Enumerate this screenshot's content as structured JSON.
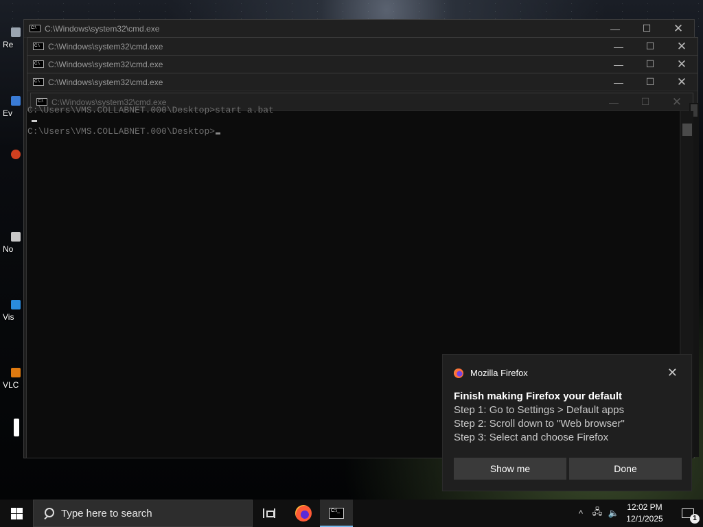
{
  "desktop": {
    "icons": [
      {
        "label": "Re",
        "color": "#9aa4b0"
      },
      {
        "label": "Ev",
        "color": "#3a7bd5"
      },
      {
        "label": "",
        "color": "#d04020"
      },
      {
        "label": "No",
        "color": "#c8c8c8"
      },
      {
        "label": "Vis",
        "color": "#2a8cde"
      },
      {
        "label": "VLC",
        "color": "#e07a10"
      },
      {
        "label": "",
        "color": "#ffffff"
      }
    ]
  },
  "windows": [
    {
      "title": "C:\\Windows\\system32\\cmd.exe",
      "icon_text": "C:\\"
    },
    {
      "title": "C:\\Windows\\system32\\cmd.exe",
      "icon_text": "C:\\"
    },
    {
      "title": "C:\\Windows\\system32\\cmd.exe",
      "icon_text": "C:\\"
    },
    {
      "title": "C:\\Windows\\system32\\cmd.exe",
      "icon_text": "C:\\"
    },
    {
      "title": "C:\\Windows\\system32\\cmd.exe",
      "icon_text": "C:\\"
    }
  ],
  "window_controls": {
    "minimize": "—",
    "maximize": "☐",
    "close": "✕"
  },
  "console": {
    "line1": "C:\\Users\\VMS.COLLABNET.000\\Desktop>start a.bat",
    "line2": "C:\\Users\\VMS.COLLABNET.000\\Desktop>"
  },
  "toast": {
    "app_name": "Mozilla Firefox",
    "close": "✕",
    "title": "Finish making Firefox your default",
    "steps": [
      "Step 1: Go to Settings > Default apps",
      "Step 2: Scroll down to \"Web browser\"",
      "Step 3: Select and choose Firefox"
    ],
    "buttons": {
      "primary": "Show me",
      "secondary": "Done"
    }
  },
  "taskbar": {
    "search_placeholder": "Type here to search",
    "cmd_icon_text": "C:\\_",
    "tray": {
      "chevron": "^",
      "network": "🖧",
      "volume": "🔈"
    },
    "clock": {
      "time": "12:02 PM",
      "date": "12/1/2025"
    },
    "notification_count": "1"
  }
}
